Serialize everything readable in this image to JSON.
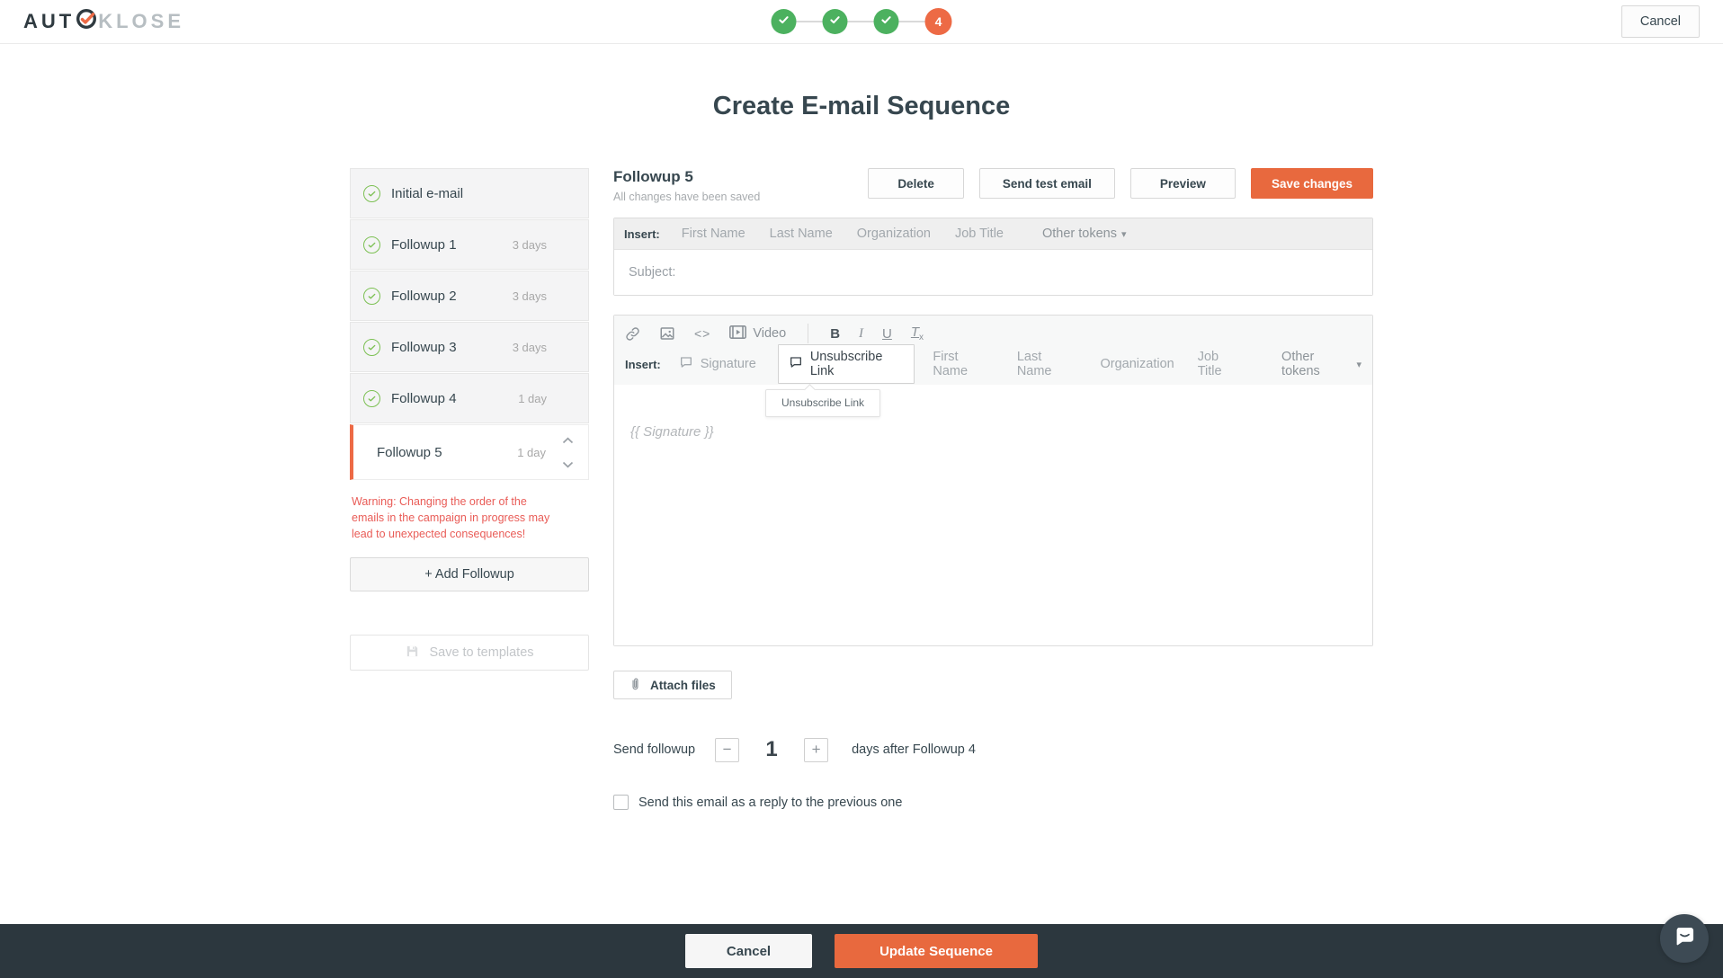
{
  "colors": {
    "accent_orange": "#e8693e",
    "active_bar_orange": "#ed6a45",
    "success_green": "#4cb15f",
    "sidebar_check_green": "#7cc053",
    "warning_red": "#e95c57",
    "footer_dark": "#2c373e",
    "text_dark": "#37474f",
    "text_gray": "#a2a8ad"
  },
  "icons": {
    "logo_o": "circle-check",
    "step_done": "check",
    "sidebar_done": "circle-check-outline",
    "reorder": "chevron-up-down",
    "link": "chain",
    "image": "picture",
    "video": "film-play",
    "bubble": "speech-bubble",
    "attach": "paperclip",
    "save_template": "floppy-disk",
    "chat": "chat-bubble",
    "caret": "▾",
    "minus": "−",
    "plus": "+"
  },
  "topbar": {
    "logo_part1": "AUT",
    "logo_part2": "KLOSE",
    "steps": [
      {
        "state": "done"
      },
      {
        "state": "done"
      },
      {
        "state": "done"
      },
      {
        "state": "current",
        "label": "4"
      }
    ],
    "cancel_label": "Cancel"
  },
  "page_title": "Create E-mail Sequence",
  "sidebar": {
    "items": [
      {
        "label": "Initial e-mail",
        "days": ""
      },
      {
        "label": "Followup 1",
        "days": "3 days"
      },
      {
        "label": "Followup 2",
        "days": "3 days"
      },
      {
        "label": "Followup 3",
        "days": "3 days"
      },
      {
        "label": "Followup 4",
        "days": "1 day"
      },
      {
        "label": "Followup 5",
        "days": "1 day"
      }
    ],
    "warning": "Warning: Changing the order of the emails in the campaign in progress may lead to unexpected consequences!",
    "add_followup_label": "+ Add Followup",
    "save_templates_label": "Save to templates"
  },
  "editor": {
    "title": "Followup 5",
    "status": "All changes have been saved",
    "buttons": {
      "delete": "Delete",
      "send_test": "Send test email",
      "preview": "Preview",
      "save": "Save changes"
    },
    "subject_insert": {
      "label": "Insert:",
      "tokens": [
        "First Name",
        "Last Name",
        "Organization",
        "Job Title"
      ],
      "other": "Other tokens"
    },
    "subject_placeholder": "Subject:",
    "toolbar": {
      "video_label": "Video",
      "code_label": "<>",
      "bold_label": "B",
      "italic_label": "I",
      "underline_label": "U",
      "clear_label": "T",
      "clear_sub": "x"
    },
    "body_insert": {
      "label": "Insert:",
      "signature": "Signature",
      "unsubscribe": "Unsubscribe Link",
      "tokens": [
        "First Name",
        "Last Name",
        "Organization",
        "Job Title"
      ],
      "other": "Other tokens"
    },
    "tooltip": "Unsubscribe Link",
    "body_placeholder": "{{ Signature }}",
    "attach_label": "Attach files",
    "schedule": {
      "prefix": "Send followup",
      "value": "1",
      "suffix": "days after Followup 4"
    },
    "reply_label": "Send this email as a reply to the previous one"
  },
  "footer": {
    "cancel": "Cancel",
    "update": "Update Sequence"
  }
}
